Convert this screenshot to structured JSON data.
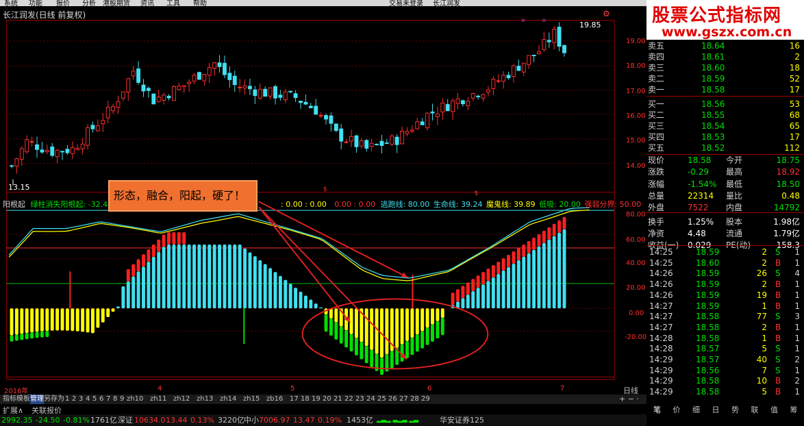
{
  "menu": [
    "系统",
    "功能",
    "报价",
    "分析",
    "港股期货",
    "资讯",
    "工具",
    "帮助"
  ],
  "menu_center": [
    "交易未登录",
    "长江润发"
  ],
  "title": "长江润发(日线 前复权)",
  "price_axis": [
    "19.00",
    "18.00",
    "17.00",
    "16.00",
    "15.00",
    "14.00"
  ],
  "high_label": "19.85",
  "low_label": "13.15",
  "indicator_header": {
    "name": "阳根起",
    "line1": "绿柱消失阳根起: -32.44",
    "vals1": ": 0.00 : 0.00",
    "vals2": "0.00 : 0.00",
    "escape": "逃跑线: 80.00",
    "life": "生命线: 39.24",
    "ghost": "魔鬼线: 39.89",
    "absorb": "低吸: 20.00",
    "strong": "强弱分界: 50.00"
  },
  "indicator_axis": [
    "80.00",
    "60.00",
    "40.00",
    "20.00",
    "0.00",
    "-20.00"
  ],
  "callout": "形态，融合，阳起，硬了！",
  "date_axis": {
    "year": "2016年",
    "labels": [
      "4",
      "5",
      "6",
      "7"
    ],
    "period": "日线"
  },
  "bottom_tabs": [
    "指标",
    "模板",
    "管理",
    "另存为",
    "1",
    "2",
    "3",
    "4",
    "5",
    "6",
    "7",
    "8",
    "9",
    "zh10",
    "zh11",
    "zh12",
    "zh13",
    "zh14",
    "zh15",
    "zb16",
    "17",
    "18",
    "19",
    "20",
    "21",
    "22",
    "23",
    "24",
    "25",
    "26",
    "27",
    "28",
    "29"
  ],
  "extra_tabs": [
    "扩展∧",
    "关联报价"
  ],
  "status": {
    "sh_val": "2992.35",
    "sh_chg": "-24.50",
    "sh_pct": "-0.81%",
    "sh_amt": "1761亿",
    "sz_label": "深证",
    "sz_val": "10634.0",
    "sz_chg": "13.44",
    "sz_pct": "0.13%",
    "sz_amt": "3220亿",
    "zx_label": "中小",
    "zx_val": "7006.97",
    "zx_chg": "13.47",
    "zx_pct": "0.19%",
    "zx_amt": "1453亿",
    "broker": "华安证券125"
  },
  "watermark": {
    "line1": "股票公式指标网",
    "line2": "www.gszx.com.cn"
  },
  "orderbook": [
    {
      "label": "卖五",
      "price": "18.64",
      "vol": "16",
      "color": "#00e000"
    },
    {
      "label": "卖四",
      "price": "18.61",
      "vol": "2",
      "color": "#00e000"
    },
    {
      "label": "卖三",
      "price": "18.60",
      "vol": "18",
      "color": "#00e000"
    },
    {
      "label": "卖二",
      "price": "18.59",
      "vol": "52",
      "color": "#00e000"
    },
    {
      "label": "卖一",
      "price": "18.58",
      "vol": "17",
      "color": "#00e000"
    },
    {
      "label": "买一",
      "price": "18.56",
      "vol": "53",
      "color": "#00e000"
    },
    {
      "label": "买二",
      "price": "18.55",
      "vol": "68",
      "color": "#00e000"
    },
    {
      "label": "买三",
      "price": "18.54",
      "vol": "65",
      "color": "#00e000"
    },
    {
      "label": "买四",
      "price": "18.53",
      "vol": "17",
      "color": "#00e000"
    },
    {
      "label": "买五",
      "price": "18.52",
      "vol": "112",
      "color": "#00e000"
    }
  ],
  "stats": [
    {
      "l1": "现价",
      "v1": "18.58",
      "c1": "#00e000",
      "l2": "今开",
      "v2": "18.75",
      "c2": "#00e000"
    },
    {
      "l1": "涨跌",
      "v1": "-0.29",
      "c1": "#00e000",
      "l2": "最高",
      "v2": "18.92",
      "c2": "#ff3030"
    },
    {
      "l1": "涨幅",
      "v1": "-1.54%",
      "c1": "#00e000",
      "l2": "最低",
      "v2": "18.50",
      "c2": "#00e000"
    },
    {
      "l1": "总量",
      "v1": "22314",
      "c1": "#ffff00",
      "l2": "量比",
      "v2": "0.48",
      "c2": "#ffff00"
    },
    {
      "l1": "外盘",
      "v1": "7522",
      "c1": "#ff3030",
      "l2": "内盘",
      "v2": "14792",
      "c2": "#00e000"
    },
    {
      "l1": "换手",
      "v1": "1.25%",
      "c1": "#ffffff",
      "l2": "股本",
      "v2": "1.98亿",
      "c2": "#ffffff"
    },
    {
      "l1": "净资",
      "v1": "4.48",
      "c1": "#ffffff",
      "l2": "流通",
      "v2": "1.79亿",
      "c2": "#ffffff"
    },
    {
      "l1": "收益(一)",
      "v1": "0.029",
      "c1": "#ffffff",
      "l2": "PE(动)",
      "v2": "158.3",
      "c2": "#ffffff"
    }
  ],
  "ticks": [
    {
      "t": "14:25",
      "p": "18.59",
      "v": "2",
      "s": "S",
      "n": "1"
    },
    {
      "t": "14:25",
      "p": "18.60",
      "v": "2",
      "s": "B",
      "n": "1"
    },
    {
      "t": "14:26",
      "p": "18.59",
      "v": "26",
      "s": "S",
      "n": "4"
    },
    {
      "t": "14:26",
      "p": "18.59",
      "v": "2",
      "s": "B",
      "n": "1"
    },
    {
      "t": "14:26",
      "p": "18.59",
      "v": "19",
      "s": "B",
      "n": "1"
    },
    {
      "t": "14:27",
      "p": "18.59",
      "v": "1",
      "s": "B",
      "n": "1"
    },
    {
      "t": "14:27",
      "p": "18.58",
      "v": "77",
      "s": "S",
      "n": "3"
    },
    {
      "t": "14:27",
      "p": "18.58",
      "v": "2",
      "s": "B",
      "n": "1"
    },
    {
      "t": "14:28",
      "p": "18.58",
      "v": "1",
      "s": "B",
      "n": "1"
    },
    {
      "t": "14:28",
      "p": "18.57",
      "v": "5",
      "s": "S",
      "n": "1"
    },
    {
      "t": "14:29",
      "p": "18.57",
      "v": "40",
      "s": "S",
      "n": "2"
    },
    {
      "t": "14:29",
      "p": "18.56",
      "v": "7",
      "s": "S",
      "n": "1"
    },
    {
      "t": "14:29",
      "p": "18.58",
      "v": "10",
      "s": "B",
      "n": "2"
    },
    {
      "t": "14:29",
      "p": "18.58",
      "v": "5",
      "s": "B",
      "n": "1"
    }
  ],
  "right_tabs": [
    "笔",
    "价",
    "细",
    "日",
    "势",
    "联",
    "值",
    "筹"
  ],
  "colors": {
    "up": "#ff3030",
    "down": "#00e0e0",
    "green": "#00e000",
    "yellow": "#ffff00",
    "cyan": "#40e0f0",
    "red": "#e00000"
  }
}
